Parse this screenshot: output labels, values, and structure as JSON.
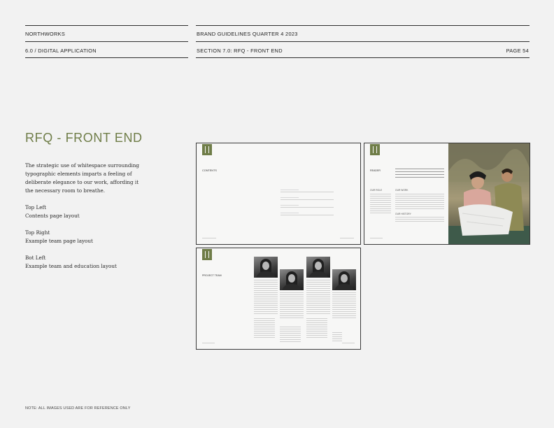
{
  "header": {
    "brand": "NORTHWORKS",
    "doc_title": "BRAND GUIDELINES QUARTER 4 2023",
    "section_left": "6.0 / DIGITAL APPLICATION",
    "section_center": "SECTION 7.0: RFQ - FRONT END",
    "page": "PAGE 54"
  },
  "main": {
    "title": "RFQ - FRONT END",
    "intro": [
      "The strategic use of whitespace surrounding",
      "typographic elements imparts a feeling of",
      "deliberate elegance to our work, affording it",
      "the necessary room to breathe."
    ],
    "captions": [
      {
        "label": "Top Left",
        "desc": "Contents page layout"
      },
      {
        "label": "Top Right",
        "desc": "Example team page layout"
      },
      {
        "label": "Bot Left",
        "desc": "Example team and education layout"
      }
    ]
  },
  "thumbnails": {
    "contents": {
      "heading": "CONTENTS"
    },
    "team": {
      "heading": "READER",
      "sub1": "OUR ROLE",
      "sub2": "OUR WORK",
      "sub3": "OUR HISTORY"
    },
    "project": {
      "heading": "PROJECT TEAM"
    }
  },
  "footer": {
    "note": "NOTE: ALL IMAGES USED ARE FOR REFERENCE ONLY"
  },
  "colors": {
    "accent": "#6f7d48",
    "background": "#f2f2f2",
    "rule": "#2f2f2f"
  }
}
